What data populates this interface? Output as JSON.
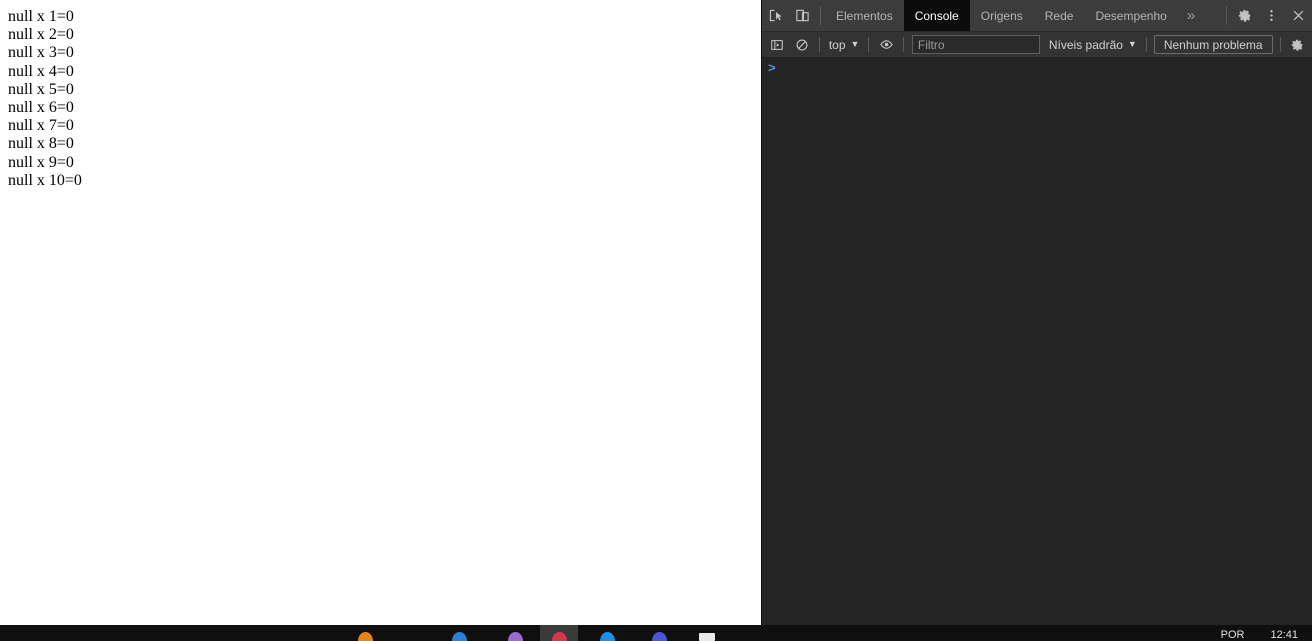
{
  "page": {
    "lines": [
      "null x 1=0",
      "null x 2=0",
      "null x 3=0",
      "null x 4=0",
      "null x 5=0",
      "null x 6=0",
      "null x 7=0",
      "null x 8=0",
      "null x 9=0",
      "null x 10=0"
    ]
  },
  "devtools": {
    "tabs": [
      {
        "label": "Elementos",
        "active": false
      },
      {
        "label": "Console",
        "active": true
      },
      {
        "label": "Origens",
        "active": false
      },
      {
        "label": "Rede",
        "active": false
      },
      {
        "label": "Desempenho",
        "active": false
      }
    ],
    "more_tabs_label": "»",
    "icons": {
      "inspect": "inspect-element-icon",
      "device": "device-toolbar-icon",
      "settings": "gear-icon",
      "kebab": "more-options-icon",
      "close": "close-icon"
    },
    "toolbar": {
      "sidebar_toggle": "console-sidebar-icon",
      "clear_console": "clear-console-icon",
      "context_label": "top",
      "context_caret": "▼",
      "live_expression": "eye-icon",
      "filter_placeholder": "Filtro",
      "filter_value": "",
      "levels_label": "Níveis padrão",
      "levels_caret": "▼",
      "issues_label": "Nenhum problema",
      "settings_icon": "gear-icon"
    },
    "console": {
      "prompt_symbol": ">",
      "input_value": ""
    },
    "colors": {
      "panel_bg": "#242424",
      "tabbar_bg": "#3c3c3c",
      "toolbar_bg": "#333333",
      "active_tab_bg": "#0b0b0b",
      "prompt_blue": "#5a8ff0",
      "text": "#b4b4b4"
    }
  },
  "taskbar": {
    "apps": [
      {
        "name": "app-orange",
        "color": "#e8821a",
        "active": false,
        "shape": "dome"
      },
      {
        "name": "app-blue",
        "color": "#2b7fd6",
        "active": false,
        "shape": "dome"
      },
      {
        "name": "app-purple",
        "color": "#9b6ad4",
        "active": false,
        "shape": "dome"
      },
      {
        "name": "app-red",
        "color": "#d63a4a",
        "active": true,
        "shape": "dome"
      },
      {
        "name": "app-skyblue",
        "color": "#1f8ee8",
        "active": false,
        "shape": "dome"
      },
      {
        "name": "app-indigo",
        "color": "#4a55d8",
        "active": false,
        "shape": "dome"
      },
      {
        "name": "app-white",
        "color": "#e9e9e9",
        "active": false,
        "shape": "sq"
      }
    ],
    "tray": {
      "language": "POR",
      "clock": "12:41"
    }
  }
}
